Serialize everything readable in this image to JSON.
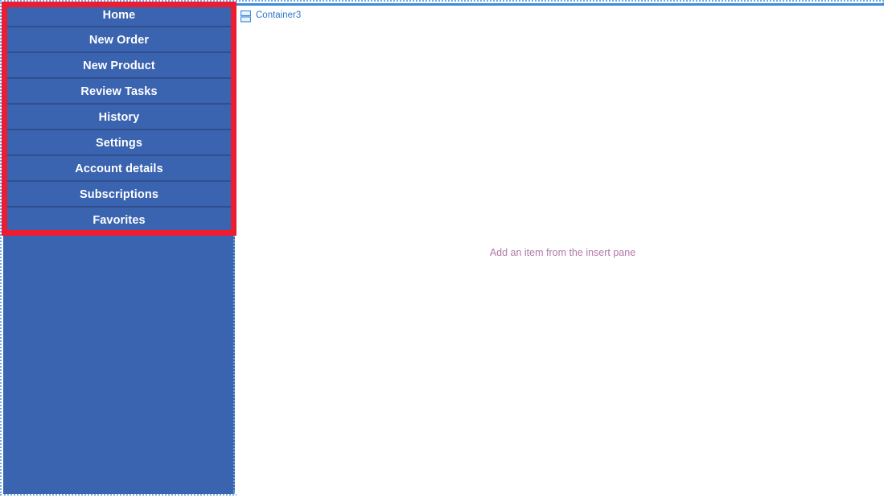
{
  "colors": {
    "nav_background": "#3A63B0",
    "nav_separator": "#2F4F8F",
    "nav_text": "#FFFFFF",
    "highlight_border": "#ED1C30",
    "canvas_border": "#6FA8DC",
    "content_top_rule": "#3C8ADC",
    "container_label_text": "#2E75C8",
    "empty_hint_text": "#B07AA8"
  },
  "nav": {
    "items": [
      {
        "label": "Home"
      },
      {
        "label": "New Order"
      },
      {
        "label": "New Product"
      },
      {
        "label": "Review Tasks"
      },
      {
        "label": "History"
      },
      {
        "label": "Settings"
      },
      {
        "label": "Account details"
      },
      {
        "label": "Subscriptions"
      },
      {
        "label": "Favorites"
      }
    ]
  },
  "content": {
    "container": {
      "icon": "split-container-icon",
      "label": "Container3"
    },
    "empty_state": {
      "message": "Add an item from the insert pane"
    }
  }
}
